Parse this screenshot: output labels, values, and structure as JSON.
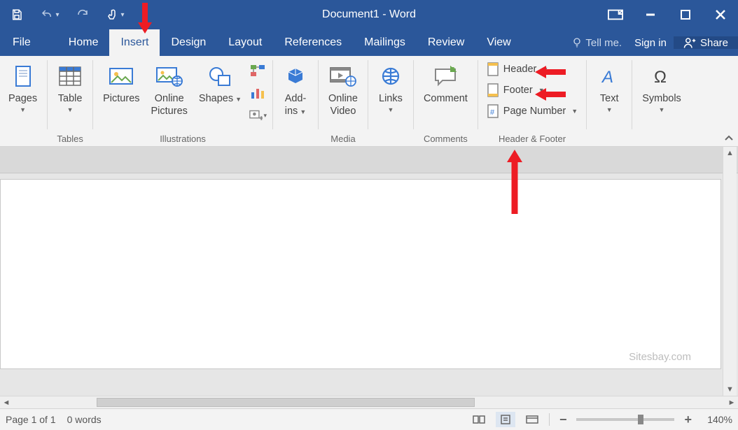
{
  "title": "Document1 - Word",
  "tabs": {
    "file": "File",
    "home": "Home",
    "insert": "Insert",
    "design": "Design",
    "layout": "Layout",
    "references": "References",
    "mailings": "Mailings",
    "review": "Review",
    "view": "View",
    "tellme": "Tell me.",
    "signin": "Sign in",
    "share": "Share"
  },
  "ribbon": {
    "pages": "Pages",
    "table": "Table",
    "tables_group": "Tables",
    "pictures": "Pictures",
    "online_pictures_1": "Online",
    "online_pictures_2": "Pictures",
    "shapes": "Shapes",
    "illustrations_group": "Illustrations",
    "addins_1": "Add-",
    "addins_2": "ins",
    "online_video_1": "Online",
    "online_video_2": "Video",
    "media_group": "Media",
    "links": "Links",
    "comment": "Comment",
    "comments_group": "Comments",
    "header": "Header",
    "footer": "Footer",
    "page_number": "Page Number",
    "hf_group": "Header & Footer",
    "text": "Text",
    "symbols": "Symbols"
  },
  "watermark": "Sitesbay.com",
  "status": {
    "page": "Page 1 of 1",
    "words": "0 words",
    "zoom": "140%"
  }
}
